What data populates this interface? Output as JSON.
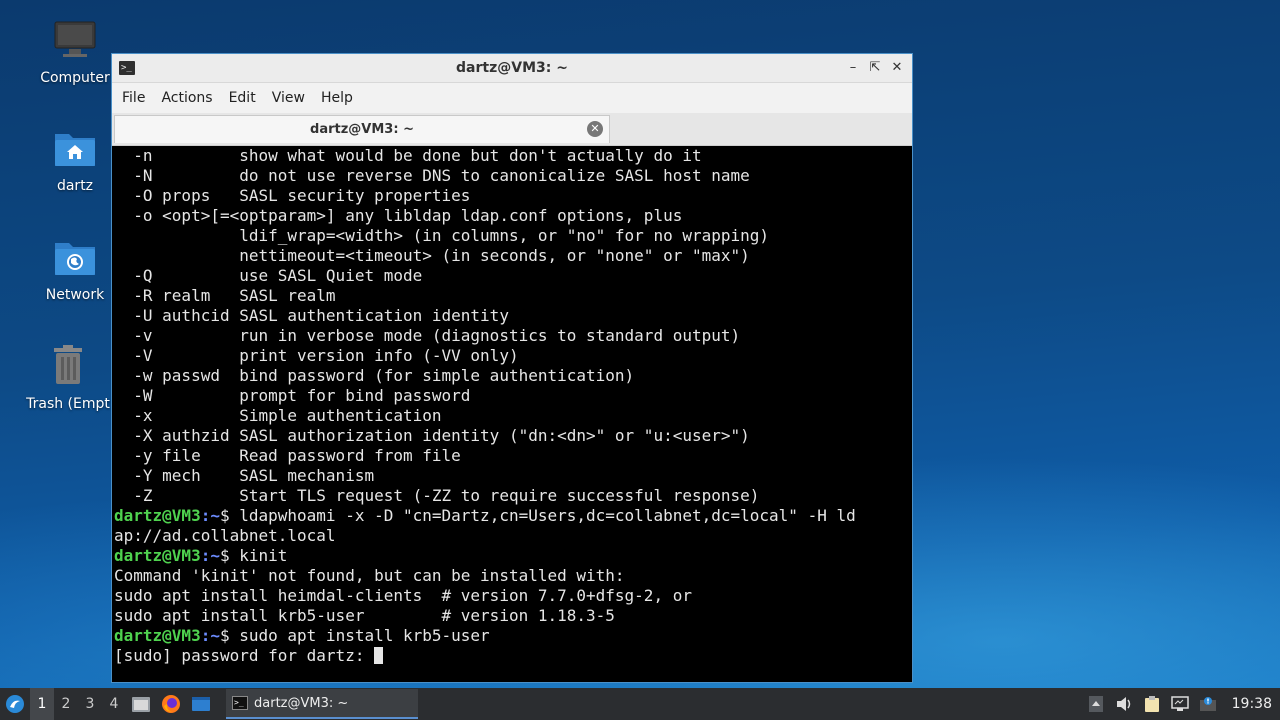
{
  "desktop": {
    "icons": [
      {
        "label": "Computer"
      },
      {
        "label": "dartz"
      },
      {
        "label": "Network"
      },
      {
        "label": "Trash (Empt"
      }
    ]
  },
  "window": {
    "title": "dartz@VM3: ~",
    "menu": [
      "File",
      "Actions",
      "Edit",
      "View",
      "Help"
    ],
    "tab_title": "dartz@VM3: ~"
  },
  "terminal": {
    "help_lines": [
      "  -n         show what would be done but don't actually do it",
      "  -N         do not use reverse DNS to canonicalize SASL host name",
      "  -O props   SASL security properties",
      "  -o <opt>[=<optparam>] any libldap ldap.conf options, plus",
      "             ldif_wrap=<width> (in columns, or \"no\" for no wrapping)",
      "             nettimeout=<timeout> (in seconds, or \"none\" or \"max\")",
      "  -Q         use SASL Quiet mode",
      "  -R realm   SASL realm",
      "  -U authcid SASL authentication identity",
      "  -v         run in verbose mode (diagnostics to standard output)",
      "  -V         print version info (-VV only)",
      "  -w passwd  bind password (for simple authentication)",
      "  -W         prompt for bind password",
      "  -x         Simple authentication",
      "  -X authzid SASL authorization identity (\"dn:<dn>\" or \"u:<user>\")",
      "  -y file    Read password from file",
      "  -Y mech    SASL mechanism",
      "  -Z         Start TLS request (-ZZ to require successful response)"
    ],
    "prompt_user": "dartz@VM3",
    "prompt_path": ":~",
    "prompt_suffix": "$ ",
    "cmd1": "ldapwhoami -x -D \"cn=Dartz,cn=Users,dc=collabnet,dc=local\" -H ld",
    "cmd1_wrap": "ap://ad.collabnet.local",
    "cmd2": "kinit",
    "out2": [
      "Command 'kinit' not found, but can be installed with:",
      "sudo apt install heimdal-clients  # version 7.7.0+dfsg-2, or",
      "sudo apt install krb5-user        # version 1.18.3-5"
    ],
    "cmd3": "sudo apt install krb5-user",
    "sudo_prompt": "[sudo] password for dartz: "
  },
  "taskbar": {
    "workspaces": [
      "1",
      "2",
      "3",
      "4"
    ],
    "active_workspace": "1",
    "task_label": "dartz@VM3: ~",
    "clock": "19:38"
  },
  "colors": {
    "prompt_user": "#4fd24f",
    "prompt_path": "#6c8cff",
    "terminal_bg": "#000000"
  }
}
